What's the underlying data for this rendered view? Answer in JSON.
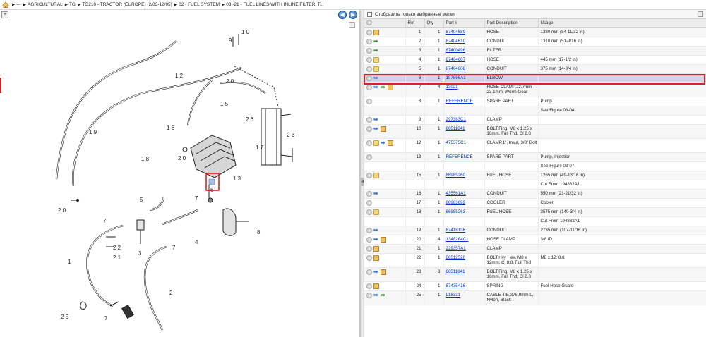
{
  "breadcrumb": [
    "---",
    "AGRICULTURAL",
    "TG",
    "TG210 - TRACTOR (EUROPE) (2/03-12/05)",
    "02 - FUEL SYSTEM",
    "03 -21 - FUEL LINES WITH INLINE FILTER, T..."
  ],
  "icons": {
    "home": "home-icon",
    "back": "back-arrow-icon",
    "forward": "forward-arrow-icon",
    "zoom": "zoom-plus-icon"
  },
  "nav": {
    "back": "◀",
    "forward": "▶",
    "zoom": "+"
  },
  "filter": {
    "label": "Отобразить только выбранные метки"
  },
  "columns": {
    "icons": "",
    "ref": "Ref",
    "qty": "Qty",
    "part": "Part #",
    "desc": "Part Description",
    "usage": "Usage"
  },
  "callouts": [
    "1 0",
    "9",
    "1 2",
    "2 0",
    "1 5",
    "2 6",
    "1 6",
    "1 9",
    "1 8",
    "2 0",
    "1 3",
    "1 7",
    "2 3",
    "6",
    "5",
    "7",
    "2 0",
    "7",
    "7",
    "3",
    "4",
    "8",
    "2 2",
    "2 1",
    "1",
    "2",
    "2 5",
    "7",
    "2 4"
  ],
  "colors": {
    "selection_frame": "#e02020",
    "link": "#0033cc",
    "selected_row": "#cfd8e8"
  },
  "rows": [
    {
      "icons": "cb",
      "ref": "1",
      "qty": "1",
      "part": "87404689",
      "desc": "HOSE",
      "usage": "1380 mm (54-11/32 in)"
    },
    {
      "icons": "cg",
      "ref": "2",
      "qty": "1",
      "part": "87404610",
      "desc": "CONDUIT",
      "usage": "1310 mm (51-9/16 in)"
    },
    {
      "icons": "cg",
      "ref": "3",
      "qty": "1",
      "part": "87400496",
      "desc": "FILTER",
      "usage": ""
    },
    {
      "icons": "cf",
      "ref": "4",
      "qty": "1",
      "part": "87404607",
      "desc": "HOSE",
      "usage": "445 mm (17-1/2 in)"
    },
    {
      "icons": "cf",
      "ref": "5",
      "qty": "1",
      "part": "87404608",
      "desc": "CONDUIT",
      "usage": "375 mm (14-3/4 in)"
    },
    {
      "icons": "ca",
      "ref": "6",
      "qty": "1",
      "part": "197895A1",
      "desc": "ELBOW",
      "usage": "",
      "selected": true
    },
    {
      "icons": "cagb",
      "ref": "7",
      "qty": "4",
      "part": "13021",
      "desc": "HOSE CLAMP,12.7mm - 23.1mm, Worm Gear",
      "usage": ""
    },
    {
      "icons": "c",
      "ref": "8",
      "qty": "1",
      "part": "REFERENCE",
      "desc": "SPARE PART",
      "usage": "Pump"
    },
    {
      "icons": "",
      "ref": "",
      "qty": "",
      "part": "",
      "desc": "",
      "usage": "See Figure 03-04"
    },
    {
      "icons": "ca",
      "ref": "9",
      "qty": "1",
      "part": "297383C1",
      "desc": "CLAMP",
      "usage": ""
    },
    {
      "icons": "cab",
      "ref": "10",
      "qty": "1",
      "part": "86511841",
      "desc": "BOLT,Flng, M8 x 1.25 x 16mm, Full Thd, Cl 8.8",
      "usage": ""
    },
    {
      "icons": "cfab",
      "ref": "12",
      "qty": "1",
      "part": "475375C1",
      "desc": "CLAMP,1\", Insul, 3/8\" Bolt",
      "usage": ""
    },
    {
      "icons": "c",
      "ref": "13",
      "qty": "1",
      "part": "REFERENCE",
      "desc": "SPARE PART",
      "usage": "Pump, Injection"
    },
    {
      "icons": "",
      "ref": "",
      "qty": "",
      "part": "",
      "desc": "",
      "usage": "See Figure 03-07"
    },
    {
      "icons": "cf",
      "ref": "15",
      "qty": "1",
      "part": "86985260",
      "desc": "FUEL HOSE",
      "usage": "1265 mm (49-13/16 in)"
    },
    {
      "icons": "",
      "ref": "",
      "qty": "",
      "part": "",
      "desc": "",
      "usage": "Cut From 194882A1"
    },
    {
      "icons": "ca",
      "ref": "16",
      "qty": "1",
      "part": "435561A1",
      "desc": "CONDUIT",
      "usage": "550 mm (21-21/32 in)"
    },
    {
      "icons": "c",
      "ref": "17",
      "qty": "1",
      "part": "86983699",
      "desc": "COOLER",
      "usage": "Cooler"
    },
    {
      "icons": "cf",
      "ref": "18",
      "qty": "1",
      "part": "86985263",
      "desc": "FUEL HOSE",
      "usage": "3575 mm (140-3/4 in)"
    },
    {
      "icons": "",
      "ref": "",
      "qty": "",
      "part": "",
      "desc": "",
      "usage": "Cut From 194882A1"
    },
    {
      "icons": "ca",
      "ref": "19",
      "qty": "1",
      "part": "87418136",
      "desc": "CONDUIT",
      "usage": "2735 mm (107-11/16 in)"
    },
    {
      "icons": "cab",
      "ref": "20",
      "qty": "4",
      "part": "1348264C1",
      "desc": "HOSE CLAMP",
      "usage": "3/8 ID"
    },
    {
      "icons": "cb",
      "ref": "21",
      "qty": "1",
      "part": "229357A1",
      "desc": "CLAMP",
      "usage": ""
    },
    {
      "icons": "cb",
      "ref": "22",
      "qty": "1",
      "part": "86512520",
      "desc": "BOLT,Hvy Hex, M8 x 12mm, Cl 8.8, Full Thd",
      "usage": "M8 x 12; 8.8"
    },
    {
      "icons": "cab",
      "ref": "23",
      "qty": "3",
      "part": "86511841",
      "desc": "BOLT,Flng, M8 x 1.25 x 16mm, Full Thd, Cl 8.8",
      "usage": ""
    },
    {
      "icons": "cb",
      "ref": "24",
      "qty": "1",
      "part": "87435416",
      "desc": "SPRING",
      "usage": "Fuel Hose Guard"
    },
    {
      "icons": "cag",
      "ref": "25",
      "qty": "1",
      "part": "L18331",
      "desc": "CABLE TIE,375.9mm L, Nylon, Black",
      "usage": ""
    }
  ]
}
